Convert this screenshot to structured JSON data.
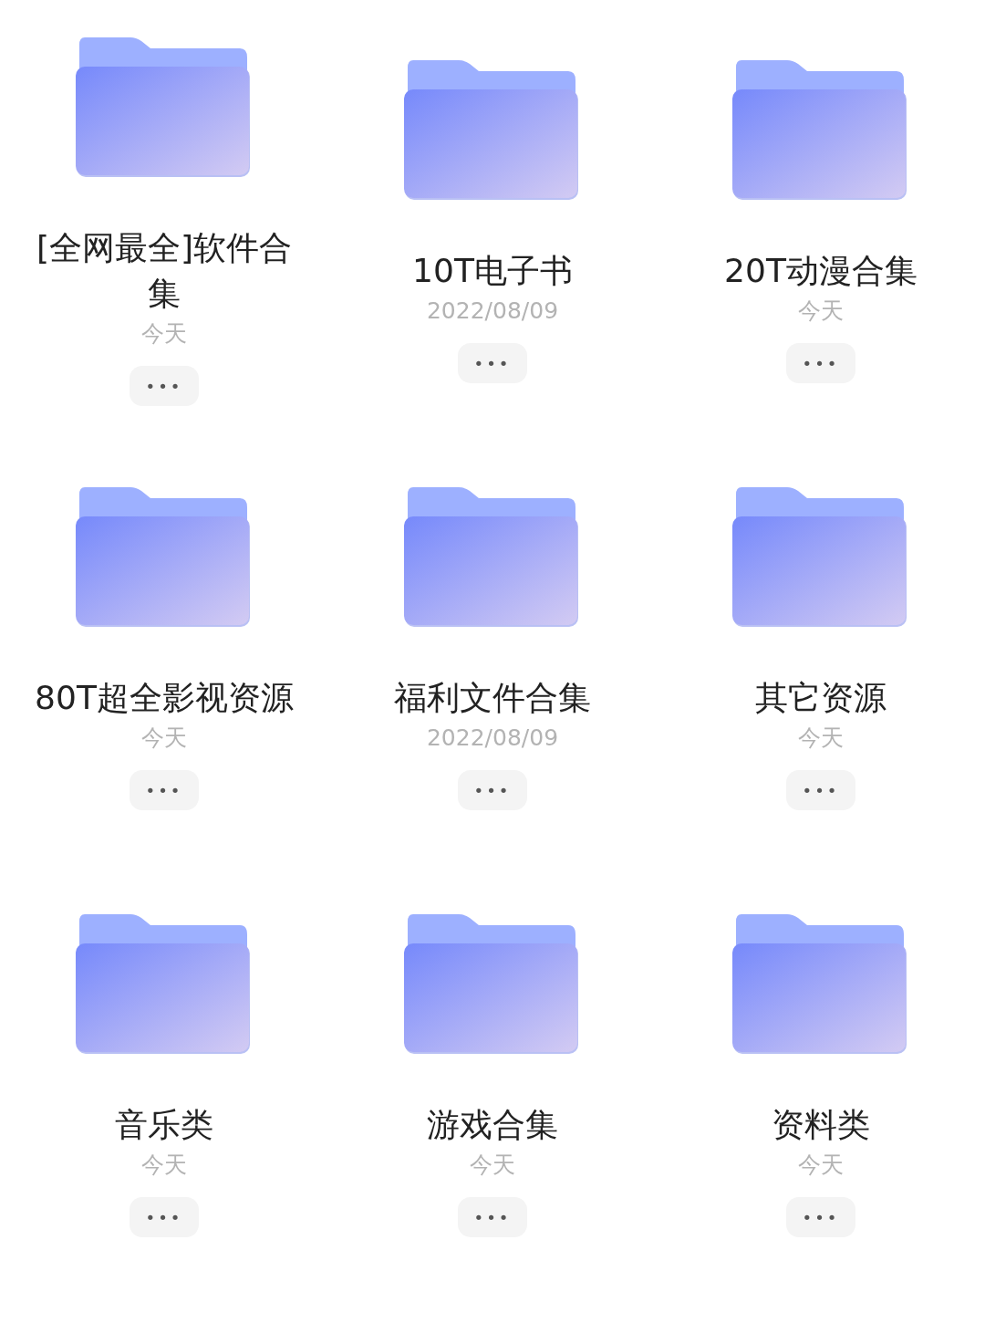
{
  "folders": [
    {
      "title": "[全网最全]软件合集",
      "date": "今天",
      "more": "•••"
    },
    {
      "title": "10T电子书",
      "date": "2022/08/09",
      "more": "•••"
    },
    {
      "title": "20T动漫合集",
      "date": "今天",
      "more": "•••"
    },
    {
      "title": "80T超全影视资源",
      "date": "今天",
      "more": "•••"
    },
    {
      "title": "福利文件合集",
      "date": "2022/08/09",
      "more": "•••"
    },
    {
      "title": "其它资源",
      "date": "今天",
      "more": "•••"
    },
    {
      "title": "音乐类",
      "date": "今天",
      "more": "•••"
    },
    {
      "title": "游戏合集",
      "date": "今天",
      "more": "•••"
    },
    {
      "title": "资料类",
      "date": "今天",
      "more": "•••"
    }
  ]
}
